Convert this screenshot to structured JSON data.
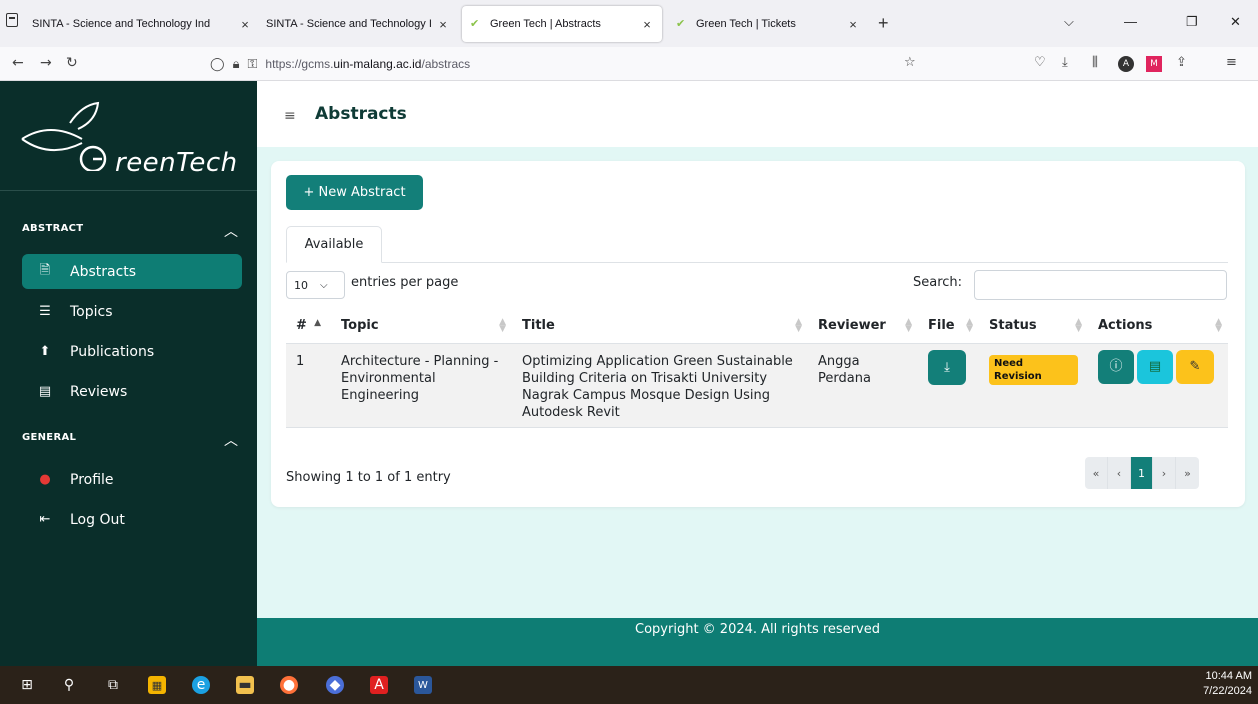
{
  "browser": {
    "tabs": [
      {
        "title": "SINTA - Science and Technology Ind",
        "close": "×"
      },
      {
        "title": "SINTA - Science and Technology Ind",
        "close": "×"
      },
      {
        "title": "Green Tech | Abstracts",
        "close": "×"
      },
      {
        "title": "Green Tech | Tickets",
        "close": "×"
      }
    ],
    "new_tab": "+",
    "url_prefix": "https://gcms.",
    "url_domain": "uin-malang.ac.id",
    "url_path": "/abstracs"
  },
  "sidebar": {
    "logo_text": "reenTech",
    "sections": [
      {
        "label": "ABSTRACT",
        "items": [
          {
            "label": "Abstracts",
            "icon": "document-icon"
          },
          {
            "label": "Topics",
            "icon": "list-icon"
          },
          {
            "label": "Publications",
            "icon": "upload-icon"
          },
          {
            "label": "Reviews",
            "icon": "comment-icon"
          }
        ]
      },
      {
        "label": "GENERAL",
        "items": [
          {
            "label": "Profile",
            "icon": "alert-icon"
          },
          {
            "label": "Log Out",
            "icon": "logout-icon"
          }
        ]
      }
    ]
  },
  "header": {
    "title": "Abstracts"
  },
  "content": {
    "new_button": "+ New Abstract",
    "tab": "Available",
    "per_page_value": "10",
    "per_page_label": "entries per page",
    "search_label": "Search:",
    "columns": [
      "#",
      "Topic",
      "Title",
      "Reviewer",
      "File",
      "Status",
      "Actions"
    ],
    "rows": [
      {
        "num": "1",
        "topic": "Architecture - Planning - Environmental Engineering",
        "title": "Optimizing Application Green Sustainable Building Criteria on Trisakti University Nagrak Campus Mosque Design Using Autodesk Revit",
        "reviewer": "Angga Perdana",
        "status": "Need Revision"
      }
    ],
    "info": "Showing 1 to 1 of 1 entry",
    "pager": [
      "«",
      "‹",
      "1",
      "›",
      "»"
    ]
  },
  "footer": {
    "text": "Copyright © 2024. All rights reserved"
  },
  "taskbar": {
    "time": "10:44 AM",
    "date": "7/22/2024"
  },
  "colors": {
    "sidebar": "#0a2e2a",
    "accent": "#137f79",
    "warning": "#fcc21b",
    "info": "#1bc5dc"
  }
}
